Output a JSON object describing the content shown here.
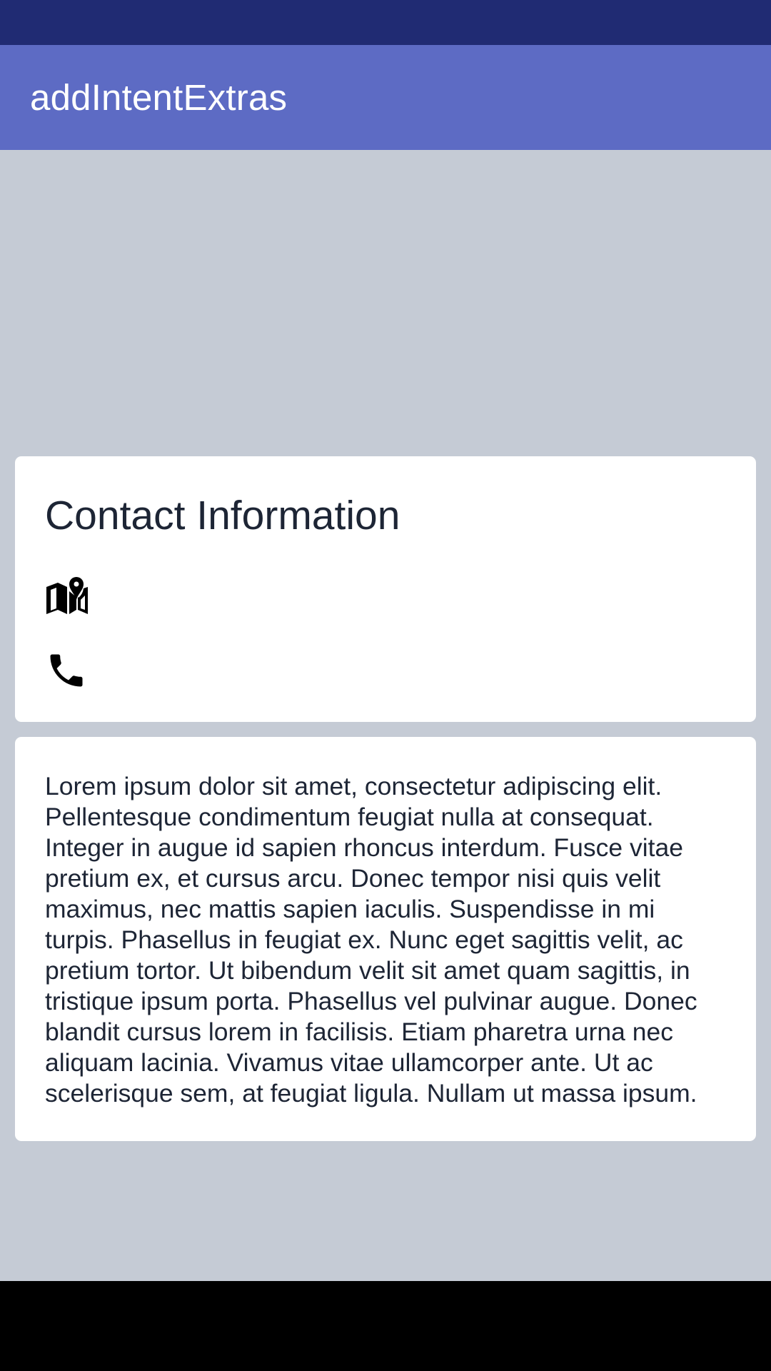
{
  "app_bar": {
    "title": "addIntentExtras"
  },
  "contact_card": {
    "title": "Contact Information",
    "icons": [
      "map-icon",
      "phone-icon"
    ]
  },
  "text_card": {
    "body": "Lorem ipsum dolor sit amet, consectetur adipiscing elit. Pellentesque condimentum feugiat nulla at consequat. Integer in augue id sapien rhoncus interdum. Fusce vitae pretium ex, et cursus arcu. Donec tempor nisi quis velit maximus, nec mattis sapien iaculis. Suspendisse in mi turpis. Phasellus in feugiat ex. Nunc eget sagittis velit, ac pretium tortor. Ut bibendum velit sit amet quam sagittis, in tristique ipsum porta. Phasellus vel pulvinar augue. Donec blandit cursus lorem in facilisis. Etiam pharetra urna nec aliquam lacinia. Vivamus vitae ullamcorper ante. Ut ac scelerisque sem, at feugiat ligula. Nullam ut massa ipsum."
  },
  "colors": {
    "status_bar": "#202b73",
    "app_bar": "#5d6bc4",
    "background": "#c5cbd5",
    "card": "#ffffff",
    "text": "#1d2535",
    "nav_bar": "#000000"
  }
}
